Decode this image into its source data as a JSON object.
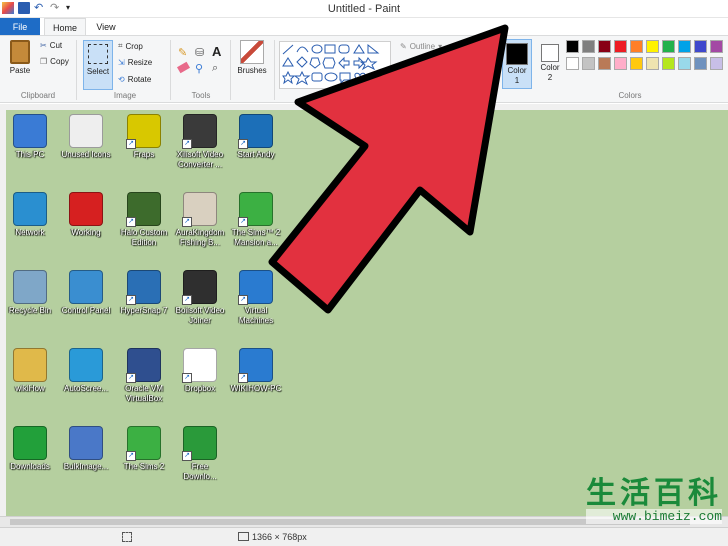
{
  "window": {
    "title": "Untitled - Paint"
  },
  "tabs": [
    {
      "label": "File"
    },
    {
      "label": "Home"
    },
    {
      "label": "View"
    }
  ],
  "ribbon": {
    "clipboard": {
      "paste": "Paste",
      "cut": "Cut",
      "copy": "Copy",
      "label": "Clipboard"
    },
    "image": {
      "select": "Select",
      "crop": "Crop",
      "resize": "Resize",
      "rotate": "Rotate",
      "label": "Image"
    },
    "tools": {
      "label": "Tools"
    },
    "brushes": {
      "label": "Brushes"
    },
    "shapes": {
      "outline": "Outline",
      "fill": "Fill",
      "label": "Shapes"
    },
    "color1": {
      "label1": "Color",
      "label2": "1",
      "color": "#000000"
    },
    "color2": {
      "label1": "Color",
      "label2": "2",
      "color": "#ffffff"
    },
    "colors": {
      "label": "Colors"
    },
    "palette_row1": [
      "#000000",
      "#7f7f7f",
      "#880015",
      "#ed1c24",
      "#ff7f27",
      "#fff200",
      "#22b14c",
      "#00a2e8",
      "#3f48cc",
      "#a349a4"
    ],
    "palette_row2": [
      "#ffffff",
      "#c3c3c3",
      "#b97a57",
      "#ffaec9",
      "#ffc90e",
      "#efe4b0",
      "#b5e61d",
      "#99d9ea",
      "#7092be",
      "#c8bfe7"
    ]
  },
  "desktop": {
    "background": "#b5cf9f",
    "icons": [
      {
        "label": "This PC",
        "icon": "computer-icon",
        "color": "#3a7bd5"
      },
      {
        "label": "Unused Icons",
        "icon": "clock-icon",
        "color": "#eeeeee"
      },
      {
        "label": "Fraps",
        "icon": "fraps-icon",
        "color": "#d8c800"
      },
      {
        "label": "Xilisoft Video Converter ...",
        "icon": "film-icon",
        "color": "#3a3a3a"
      },
      {
        "label": "Start Andy",
        "icon": "andy-icon",
        "color": "#1c6fb8"
      },
      {
        "label": "Network",
        "icon": "network-icon",
        "color": "#2a8fd0"
      },
      {
        "label": "Working",
        "icon": "no-sign-icon",
        "color": "#d62020"
      },
      {
        "label": "Halo Custom Edition",
        "icon": "halo-icon",
        "color": "#3d6b2c"
      },
      {
        "label": "AuraKingdom Fishing B...",
        "icon": "aura-icon",
        "color": "#d9d0c0"
      },
      {
        "label": "The Sims™ 2 Mansion a...",
        "icon": "sims-icon",
        "color": "#3cb043"
      },
      {
        "label": "Recycle Bin",
        "icon": "recycle-bin-icon",
        "color": "#7fa7c8"
      },
      {
        "label": "Control Panel",
        "icon": "control-panel-icon",
        "color": "#3a8ed0"
      },
      {
        "label": "HyperSnap 7",
        "icon": "camera-icon",
        "color": "#2a6fb5"
      },
      {
        "label": "Boilsoft Video Joiner",
        "icon": "video-joiner-icon",
        "color": "#2f2f2f"
      },
      {
        "label": "Virtual Machines",
        "icon": "monitor-icon",
        "color": "#2a7bd0"
      },
      {
        "label": "wikiHow",
        "icon": "user-folder-icon",
        "color": "#e0b94a"
      },
      {
        "label": "AutoScree...",
        "icon": "screen-icon",
        "color": "#2a9ad8"
      },
      {
        "label": "Oracle VM VirtualBox",
        "icon": "virtualbox-icon",
        "color": "#2f4f8f"
      },
      {
        "label": "Dropbox",
        "icon": "dropbox-icon",
        "color": "#ffffff"
      },
      {
        "label": "WIKIHOW-PC",
        "icon": "monitor-icon",
        "color": "#2a7bd0"
      },
      {
        "label": "Downloads",
        "icon": "download-icon",
        "color": "#22a03a"
      },
      {
        "label": "BulkImage...",
        "icon": "gear-icon",
        "color": "#4a78c8"
      },
      {
        "label": "The Sims 2",
        "icon": "sims-icon",
        "color": "#3cb043"
      },
      {
        "label": "Free Downlo...",
        "icon": "free-download-icon",
        "color": "#2a9a3a"
      }
    ]
  },
  "status": {
    "size": "1366 × 768px"
  },
  "watermark": {
    "text": "生活百科",
    "url": "www.bimeiz.com"
  }
}
